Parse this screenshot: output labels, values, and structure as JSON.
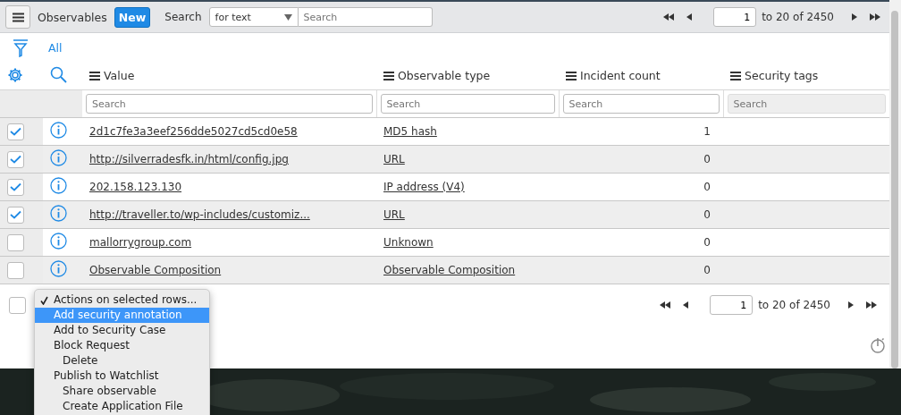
{
  "toolbar": {
    "title": "Observables",
    "new_button": "New",
    "search_label": "Search",
    "search_field": {
      "value": "for text"
    },
    "search_input": {
      "placeholder": "Search"
    },
    "pager": {
      "page": "1",
      "range": "to 20 of 2450"
    }
  },
  "filter": {
    "label": "All"
  },
  "table": {
    "columns": [
      {
        "label": "Value",
        "filter": {
          "placeholder": "Search",
          "disabled": false
        }
      },
      {
        "label": "Observable type",
        "filter": {
          "placeholder": "Search",
          "disabled": false
        }
      },
      {
        "label": "Incident count",
        "filter": {
          "placeholder": "Search",
          "disabled": false
        }
      },
      {
        "label": "Security tags",
        "filter": {
          "placeholder": "Search",
          "disabled": true
        }
      }
    ],
    "rows": [
      {
        "checked": true,
        "value": "2d1c7fe3a3eef256dde5027cd5cd0e58",
        "type": "MD5 hash",
        "count": "1"
      },
      {
        "checked": true,
        "value": "http://silverradesfk.in/html/config.jpg",
        "type": "URL",
        "count": "0"
      },
      {
        "checked": true,
        "value": "202.158.123.130",
        "type": "IP address (V4)",
        "count": "0"
      },
      {
        "checked": true,
        "value": "http://traveller.to/wp-includes/customiz...",
        "type": "URL",
        "count": "0"
      },
      {
        "checked": false,
        "value": "mallorrygroup.com",
        "type": "Unknown",
        "count": "0"
      },
      {
        "checked": false,
        "value": "Observable Composition",
        "type": "Observable Composition",
        "count": "0"
      }
    ]
  },
  "footer": {
    "select_all": {
      "checked": false
    },
    "pager": {
      "page": "1",
      "range": "to 20 of 2450"
    }
  },
  "actions_menu": {
    "items": [
      {
        "label": "Actions on selected rows...",
        "checked": true,
        "selected": false
      },
      {
        "label": "Add security annotation",
        "checked": false,
        "selected": true
      },
      {
        "label": "Add to Security Case",
        "checked": false,
        "selected": false
      },
      {
        "label": "Block Request",
        "checked": false,
        "selected": false,
        "children": [
          {
            "label": "Delete",
            "checked": false,
            "selected": false
          }
        ]
      },
      {
        "label": "Publish to Watchlist",
        "checked": false,
        "selected": false,
        "children": [
          {
            "label": "Share observable",
            "checked": false,
            "selected": false
          },
          {
            "label": "Create Application File",
            "checked": false,
            "selected": false
          }
        ]
      }
    ]
  }
}
